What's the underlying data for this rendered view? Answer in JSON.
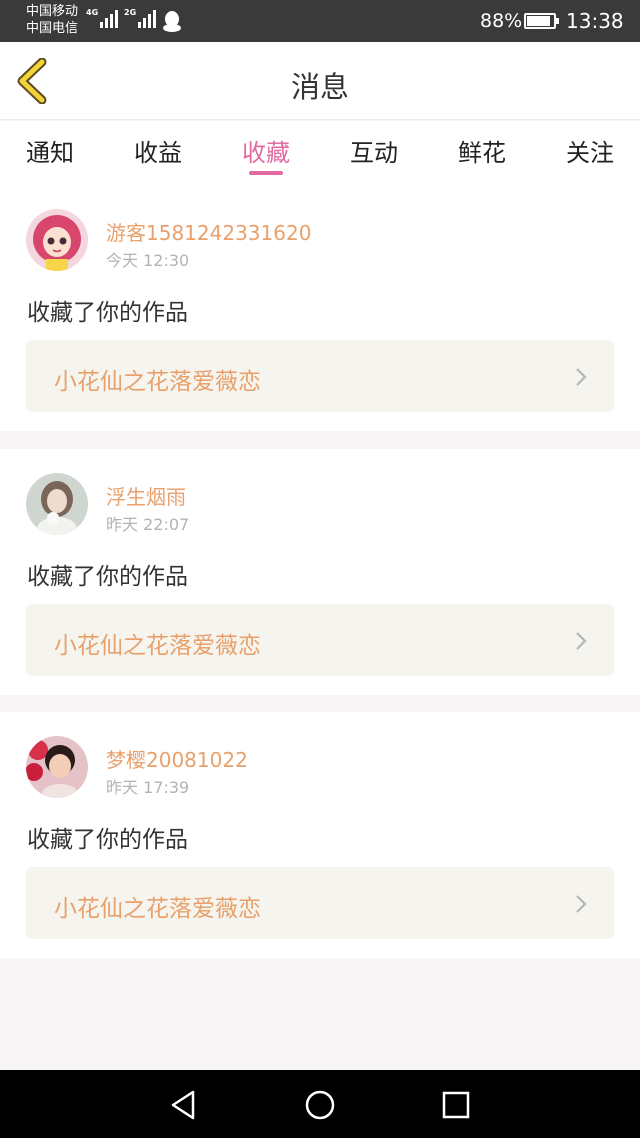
{
  "status_bar": {
    "carrier_1": "中国移动",
    "carrier_2": "中国电信",
    "net_1": "4G",
    "net_2": "2G",
    "battery_pct": "88%",
    "battery_level": 0.88,
    "time": "13:38"
  },
  "header": {
    "title": "消息",
    "back_icon": "chevron-left-icon",
    "accent": "#f0d43a"
  },
  "tabs": [
    {
      "label": "通知",
      "active": false
    },
    {
      "label": "收益",
      "active": false
    },
    {
      "label": "收藏",
      "active": true
    },
    {
      "label": "互动",
      "active": false
    },
    {
      "label": "鲜花",
      "active": false
    },
    {
      "label": "关注",
      "active": false
    }
  ],
  "colors": {
    "active_tab": "#e26ca2",
    "username": "#e8a06c",
    "work_title": "#e8a06c",
    "time": "#b3b3b3",
    "work_bg": "#f5f4ee"
  },
  "notifications": [
    {
      "username": "游客1581242331620",
      "time": "今天 12:30",
      "action": "收藏了你的作品",
      "work_title": "小花仙之花落爱薇恋"
    },
    {
      "username": "浮生烟雨",
      "time": "昨天 22:07",
      "action": "收藏了你的作品",
      "work_title": "小花仙之花落爱薇恋"
    },
    {
      "username": "梦樱20081022",
      "time": "昨天 17:39",
      "action": "收藏了你的作品",
      "work_title": "小花仙之花落爱薇恋"
    }
  ],
  "nav_bar": {
    "back_icon": "triangle-back-icon",
    "home_icon": "circle-home-icon",
    "recent_icon": "square-recents-icon"
  }
}
